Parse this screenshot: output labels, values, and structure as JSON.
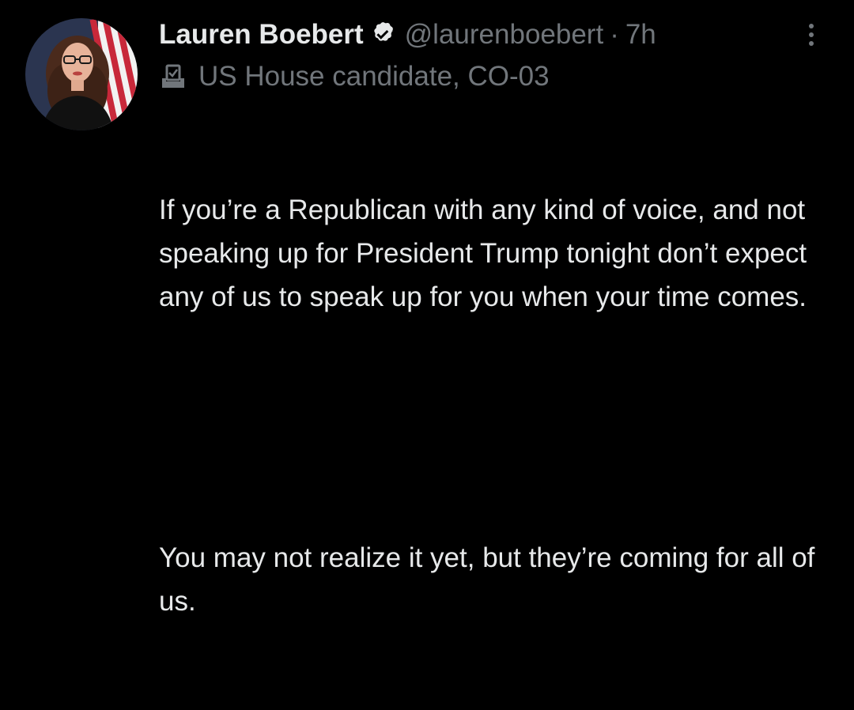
{
  "tweet": {
    "author": {
      "display_name": "Lauren Boebert",
      "verified_icon": "verified-badge-icon",
      "handle": "@laurenboebert",
      "separator": "·",
      "time": "7h",
      "label_icon": "ballot-box-icon",
      "label": "US House candidate, CO-03"
    },
    "more_icon": "more-options-icon",
    "text": {
      "paragraph_1": "If you’re a Republican with any kind of voice, and not speaking up for President Trump tonight don’t expect any of us to speak up for you when your time comes.",
      "paragraph_2": "You may not realize it yet, but they’re coming for all of us."
    }
  },
  "colors": {
    "background": "#000000",
    "primary_text": "#e7e9ea",
    "secondary_text": "#71767b"
  }
}
